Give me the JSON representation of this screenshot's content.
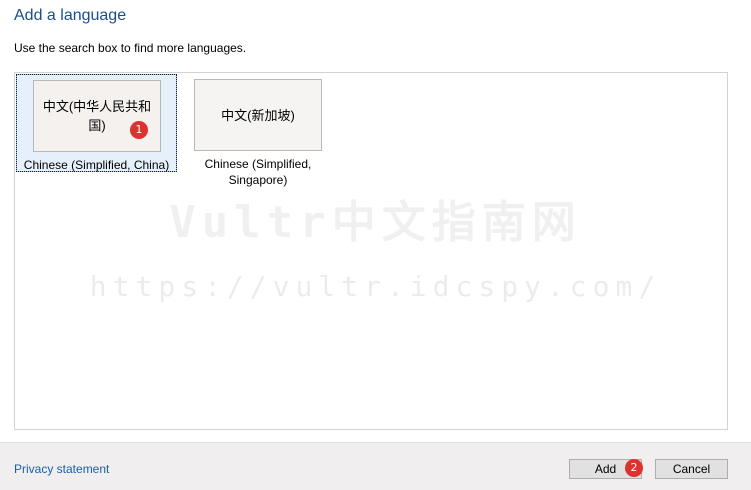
{
  "dialog": {
    "title": "Add a language",
    "instruction": "Use the search box to find more languages."
  },
  "languages": [
    {
      "native_name": "中文(中华人民共和国)",
      "english_name": "Chinese (Simplified, China)",
      "selected": true,
      "badge": "1"
    },
    {
      "native_name": "中文(新加坡)",
      "english_name": "Chinese (Simplified, Singapore)",
      "selected": false
    }
  ],
  "watermark": {
    "line1": "Vultr中文指南网",
    "line2": "https://vultr.idcspy.com/"
  },
  "footer": {
    "privacy_label": "Privacy statement",
    "add_label": "Add",
    "add_badge": "2",
    "cancel_label": "Cancel"
  },
  "colors": {
    "title": "#1a4f8c",
    "link": "#1a5ea8",
    "selection_bg": "#e5f0fa",
    "badge": "#e03131"
  }
}
